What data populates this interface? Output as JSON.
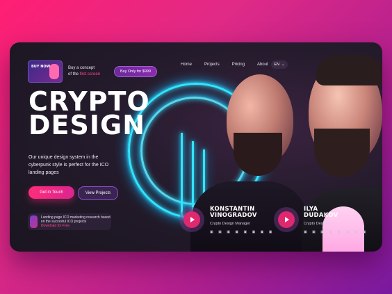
{
  "header": {
    "promo_text_a": "Buy a concept",
    "promo_text_b": "of the",
    "promo_highlight": "first screen",
    "promo_thumb_label": "BUY NOW",
    "buy_button": "Buy Only for $999",
    "nav": [
      "Home",
      "Projects",
      "Pricing",
      "About"
    ],
    "language": "EN"
  },
  "hero": {
    "title_line1": "CRYPTO",
    "title_line2": "DESIGN",
    "subtitle": "Our unique design system in the cyberpunk style is perfect for the ICO landing pages",
    "primary_button": "Get in Touch",
    "secondary_button": "View Projects"
  },
  "research": {
    "text": "Landing page ICO marketing research based on the succesful ICO projects",
    "download": "Download for Free"
  },
  "speakers": [
    {
      "name_line1": "KONSTANTIN",
      "name_line2": "VINOGRADOV",
      "role": "Crypto Design Manager",
      "socials": "▣ ▣ ▣ ▣ ▣ ▣ ▣ ▣"
    },
    {
      "name_line1": "ILYA",
      "name_line2": "DUDAKOV",
      "role": "Crypto Designer",
      "socials": "▣ ▣ ▣ ▣ ▣ ▣ ▣ ▣"
    }
  ],
  "colors": {
    "accent": "#ff2d7a",
    "neon": "#34e4ff",
    "background": "#241b2c"
  }
}
